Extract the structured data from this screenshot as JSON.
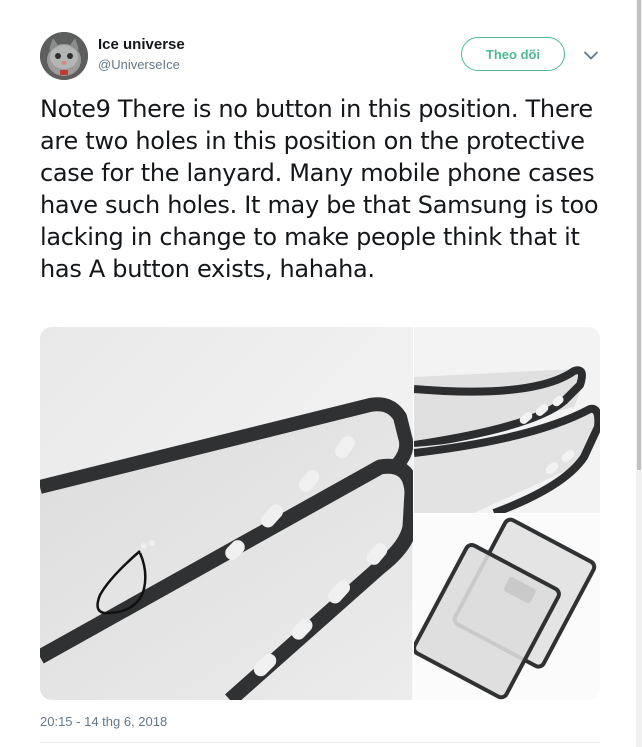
{
  "author": {
    "name": "Ice universe",
    "handle": "@UniverseIce",
    "avatar_icon": "cat-avatar"
  },
  "follow_button": {
    "label": "Theo dõi",
    "color": "#4fb896"
  },
  "menu": {
    "icon": "chevron-down-icon"
  },
  "tweet": {
    "text": "Note9 There is no button in this position. There are two holes in this position on the protective case for the lanyard. Many mobile phone cases have such holes. It may be that Samsung is too lacking in change to make people think that it has A button exists, hahaha.",
    "timestamp": "20:15 - 14 thg 6, 2018"
  },
  "media": {
    "photos": [
      {
        "name": "phone-case-closeup-with-lanyard-drawing"
      },
      {
        "name": "phone-case-corner-stacked"
      },
      {
        "name": "phone-cases-flat-pair"
      }
    ]
  },
  "colors": {
    "text": "#14171a",
    "secondary": "#657786",
    "accent": "#4fb896",
    "divider": "#e6ecf0"
  }
}
